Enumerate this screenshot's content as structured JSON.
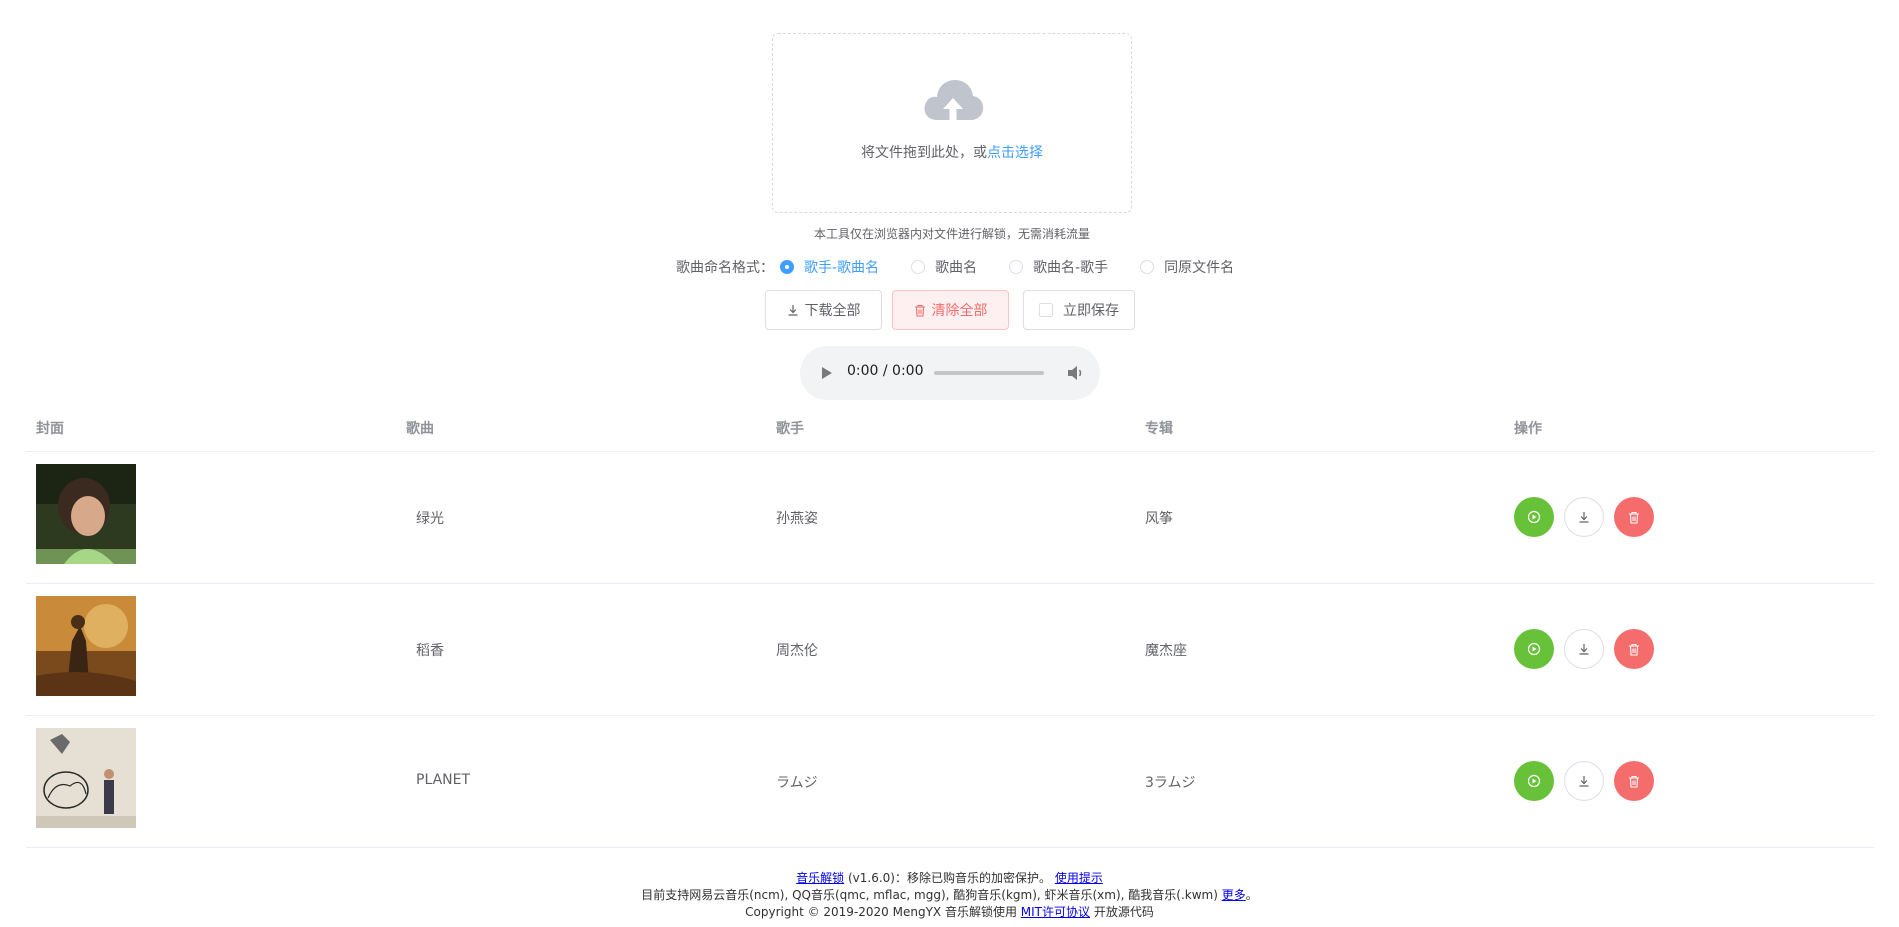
{
  "upload": {
    "text": "将文件拖到此处，或",
    "link": "点击选择",
    "tip": "本工具仅在浏览器内对文件进行解锁，无需消耗流量"
  },
  "naming": {
    "label": "歌曲命名格式：",
    "options": [
      {
        "label": "歌手-歌曲名",
        "checked": true
      },
      {
        "label": "歌曲名",
        "checked": false
      },
      {
        "label": "歌曲名-歌手",
        "checked": false
      },
      {
        "label": "同原文件名",
        "checked": false
      }
    ]
  },
  "buttons": {
    "download_all": "下载全部",
    "clear_all": "清除全部",
    "save_now": "立即保存"
  },
  "player": {
    "time": "0:00 / 0:00"
  },
  "table": {
    "headers": [
      "封面",
      "歌曲",
      "歌手",
      "专辑",
      "操作"
    ],
    "rows": [
      {
        "title": "绿光",
        "artist": "孙燕姿",
        "album": "风筝"
      },
      {
        "title": "稻香",
        "artist": "周杰伦",
        "album": "魔杰座"
      },
      {
        "title": "PLANET",
        "artist": "ラムジ",
        "album": "3ラムジ"
      }
    ]
  },
  "footer": {
    "app_link": "音乐解锁",
    "line1_text": " (v1.6.0)：移除已购音乐的加密保护。 ",
    "help_link": "使用提示",
    "line2_text": "目前支持网易云音乐(ncm), QQ音乐(qmc, mflac, mgg), 酷狗音乐(kgm), 虾米音乐(xm), 酷我音乐(.kwm) ",
    "more_link": "更多",
    "line2_end": "。",
    "line3_text": "Copyright © 2019-2020 MengYX 音乐解锁使用 ",
    "license_link": "MIT许可协议",
    "line3_end": " 开放源代码"
  },
  "colors": {
    "primary": "#409eff",
    "success": "#67c23a",
    "danger": "#f56c6c"
  }
}
